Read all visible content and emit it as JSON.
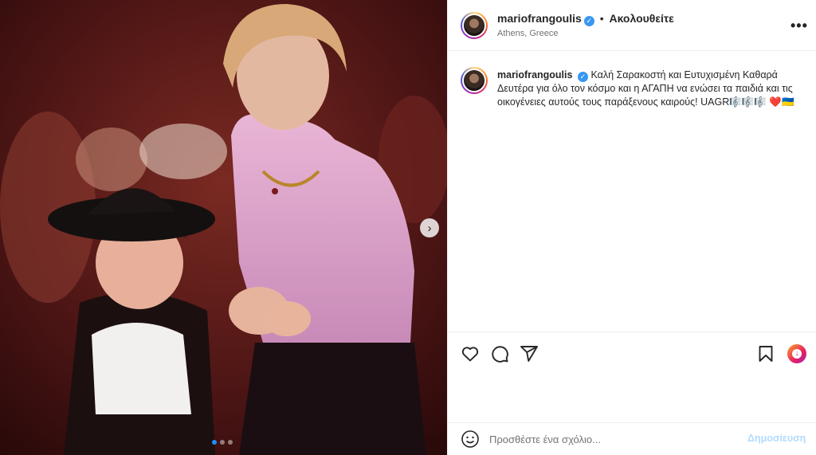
{
  "post": {
    "username": "mariofrangoulis",
    "verified_glyph": "✓",
    "follow_label": "Ακολουθείτε",
    "separator": "•",
    "location": "Athens, Greece",
    "more_glyph": "•••",
    "caption": "Καλή Σαρακοστή και Ευτυχισμένη Καθαρά Δευτέρα για όλο τον κόσμο και η ΑΓΑΠΗ να ενώσει τα παιδιά και τις οικογένειες αυτούς τους παράξενους καιρούς! UAGR🎼🎼🎼 ❤️🇺🇦",
    "carousel": {
      "current_index": 1,
      "total": 3,
      "next_glyph": "›"
    }
  },
  "actions": {
    "like_icon": "heart-outline",
    "comment_icon": "speech-bubble",
    "share_icon": "paper-plane",
    "save_icon": "bookmark-outline"
  },
  "comment_bar": {
    "placeholder": "Προσθέστε ένα σχόλιο...",
    "post_label": "Δημοσίευση",
    "post_color": "#b3dbff"
  },
  "colors": {
    "verified": "#3897f0",
    "accent": "#0095f6"
  }
}
